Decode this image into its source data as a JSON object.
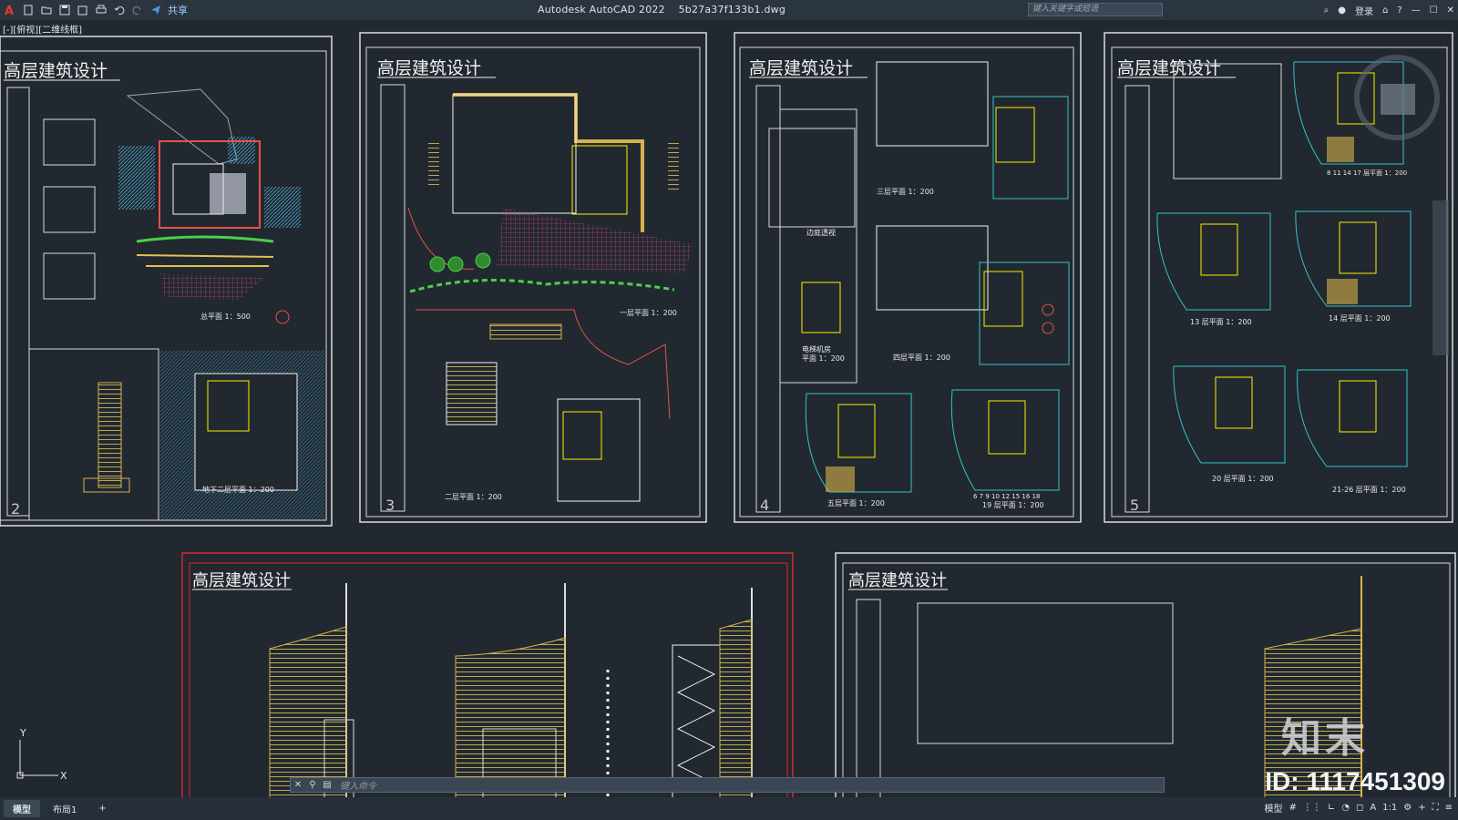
{
  "app": {
    "title": "Autodesk AutoCAD 2022",
    "file": "5b27a37f133b1.dwg",
    "share_label": "共享",
    "search_placeholder": "键入关键字或短语",
    "login_label": "登录",
    "help_label": "?"
  },
  "viewport": {
    "label": "[-][俯视][二维线框]",
    "ucs_y": "Y",
    "ucs_x": "X"
  },
  "sheets": [
    {
      "title": "高层建筑设计",
      "number": "2",
      "captions": [
        "总平面 1：500",
        "地下二层平面 1：200"
      ]
    },
    {
      "title": "高层建筑设计",
      "number": "3",
      "captions": [
        "一层平面 1：200",
        "二层平面 1：200"
      ]
    },
    {
      "title": "高层建筑设计",
      "number": "4",
      "captions": [
        "三层平面 1：200",
        "边庭透视",
        "电梯机房",
        "平面 1：200",
        "四层平面 1：200",
        "五层平面 1：200",
        "6 7 9 10 12 15 16 18",
        "19 层平面 1：200"
      ]
    },
    {
      "title": "高层建筑设计",
      "number": "5",
      "captions": [
        "8 11 14 17 层平面 1：200",
        "13 层平面 1：200",
        "14 层平面 1：200",
        "20 层平面 1：200",
        "21-26 层平面 1：200"
      ]
    },
    {
      "title": "高层建筑设计",
      "number": ""
    },
    {
      "title": "高层建筑设计",
      "number": ""
    }
  ],
  "command_line": {
    "placeholder": "键入命令"
  },
  "status": {
    "tabs": [
      "模型",
      "布局1",
      "+"
    ],
    "model_label": "模型",
    "scale": "1:1"
  },
  "watermark": {
    "logo": "知末",
    "id": "ID: 1117451309"
  },
  "colors": {
    "background": "#212830",
    "frame": "#e8e8e8",
    "wall": "#f2f2f2",
    "column": "#ffee00",
    "accent_cyan": "#33c6c6",
    "red": "#d62a2a"
  }
}
